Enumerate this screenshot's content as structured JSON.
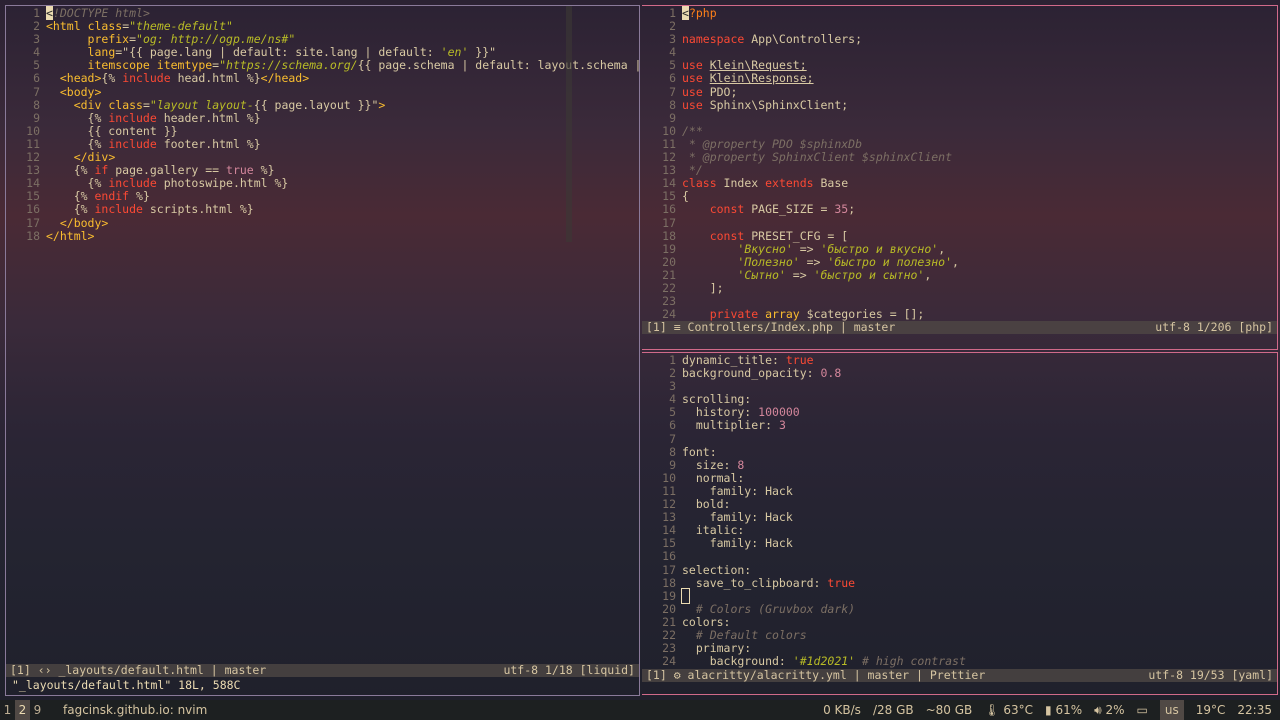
{
  "left_pane": {
    "lines": [
      {
        "n": "1",
        "html": "<span class='cursor'>&lt;</span><span class='cmt'>!DOCTYPE html&gt;</span>"
      },
      {
        "n": "2",
        "html": "<span class='tag'>&lt;html</span> <span class='attr'>class</span>=<span class='str'>\"theme-default\"</span>"
      },
      {
        "n": "3",
        "html": "      <span class='attr'>prefix</span>=<span class='str'>\"og: http://ogp.me/ns#\"</span>"
      },
      {
        "n": "4",
        "html": "      <span class='attr'>lang</span>=\"{{ page.lang | default: site.lang | default: <span class='str'>'en'</span> }}\""
      },
      {
        "n": "5",
        "html": "      <span class='attr'>itemscope itemtype</span>=<span class='str'>\"https://schema.org/</span>{{ page.schema | default: layout.schema | def"
      },
      {
        "n": "6",
        "html": "  <span class='tag'>&lt;head&gt;</span>{% <span class='kw'>include</span> head.html %}<span class='tag'>&lt;/head&gt;</span>"
      },
      {
        "n": "7",
        "html": "  <span class='tag'>&lt;body&gt;</span>"
      },
      {
        "n": "8",
        "html": "    <span class='tag'>&lt;div</span> <span class='attr'>class</span>=<span class='str'>\"layout layout-</span>{{ page.layout }}\"<span class='tag'>&gt;</span>"
      },
      {
        "n": "9",
        "html": "      {% <span class='kw'>include</span> header.html %}"
      },
      {
        "n": "10",
        "html": "      {{ content }}"
      },
      {
        "n": "11",
        "html": "      {% <span class='kw'>include</span> footer.html %}"
      },
      {
        "n": "12",
        "html": "    <span class='tag'>&lt;/div&gt;</span>"
      },
      {
        "n": "13",
        "html": "    {% <span class='kw'>if</span> page.gallery == <span class='num'>true</span> %}"
      },
      {
        "n": "14",
        "html": "      {% <span class='kw'>include</span> photoswipe.html %}"
      },
      {
        "n": "15",
        "html": "    {% <span class='kw'>endif</span> %}"
      },
      {
        "n": "16",
        "html": "    {% <span class='kw'>include</span> scripts.html %}"
      },
      {
        "n": "17",
        "html": "  <span class='tag'>&lt;/body&gt;</span>"
      },
      {
        "n": "18",
        "html": "<span class='tag'>&lt;/html&gt;</span>"
      }
    ],
    "status_left": "[1] ‹› _layouts/default.html | master",
    "status_right": "utf-8 1/18 [liquid]",
    "cmdline": "\"_layouts/default.html\" 18L, 588C"
  },
  "top_right_pane": {
    "lines": [
      {
        "n": "1",
        "html": "<span class='cursor'>&lt;</span><span class='orange'>?php</span>"
      },
      {
        "n": "2",
        "html": ""
      },
      {
        "n": "3",
        "html": "<span class='kw'>namespace</span> App\\Controllers;"
      },
      {
        "n": "4",
        "html": ""
      },
      {
        "n": "5",
        "html": "<span class='kw'>use</span> <u>Klein\\Request;</u>"
      },
      {
        "n": "6",
        "html": "<span class='kw'>use</span> <u>Klein\\Response;</u>"
      },
      {
        "n": "7",
        "html": "<span class='kw'>use</span> PDO;"
      },
      {
        "n": "8",
        "html": "<span class='kw'>use</span> Sphinx\\SphinxClient;"
      },
      {
        "n": "9",
        "html": ""
      },
      {
        "n": "10",
        "html": "<span class='cmt'>/**</span>"
      },
      {
        "n": "11",
        "html": "<span class='cmt'> * @property PDO $sphinxDb</span>"
      },
      {
        "n": "12",
        "html": "<span class='cmt'> * @property SphinxClient $sphinxClient</span>"
      },
      {
        "n": "13",
        "html": "<span class='cmt'> */</span>"
      },
      {
        "n": "14",
        "html": "<span class='kw'>class</span> Index <span class='kw'>extends</span> Base"
      },
      {
        "n": "15",
        "html": "{"
      },
      {
        "n": "16",
        "html": "    <span class='kw'>const</span> PAGE_SIZE = <span class='num'>35</span>;"
      },
      {
        "n": "17",
        "html": ""
      },
      {
        "n": "18",
        "html": "    <span class='kw'>const</span> PRESET_CFG = ["
      },
      {
        "n": "19",
        "html": "        <span class='str'>'Вкусно'</span> =&gt; <span class='str'>'быстро и вкусно'</span>,"
      },
      {
        "n": "20",
        "html": "        <span class='str'>'Полезно'</span> =&gt; <span class='str'>'быстро и полезно'</span>,"
      },
      {
        "n": "21",
        "html": "        <span class='str'>'Сытно'</span> =&gt; <span class='str'>'быстро и сытно'</span>,"
      },
      {
        "n": "22",
        "html": "    ];"
      },
      {
        "n": "23",
        "html": ""
      },
      {
        "n": "24",
        "html": "    <span class='kw'>private</span> <span class='tag'>array</span> $categories = [];"
      }
    ],
    "status_left": "[1] ≡ Controllers/Index.php | master",
    "status_right": "utf-8 1/206 [php]"
  },
  "bottom_right_pane": {
    "lines": [
      {
        "n": "1",
        "html": "dynamic_title: <span class='kw'>true</span>"
      },
      {
        "n": "2",
        "html": "background_opacity: <span class='num'>0.8</span>"
      },
      {
        "n": "3",
        "html": ""
      },
      {
        "n": "4",
        "html": "scrolling:"
      },
      {
        "n": "5",
        "html": "  history: <span class='num'>100000</span>"
      },
      {
        "n": "6",
        "html": "  multiplier: <span class='num'>3</span>"
      },
      {
        "n": "7",
        "html": ""
      },
      {
        "n": "8",
        "html": "font:"
      },
      {
        "n": "9",
        "html": "  size: <span class='num'>8</span>"
      },
      {
        "n": "10",
        "html": "  normal:"
      },
      {
        "n": "11",
        "html": "    family: Hack"
      },
      {
        "n": "12",
        "html": "  bold:"
      },
      {
        "n": "13",
        "html": "    family: Hack"
      },
      {
        "n": "14",
        "html": "  italic:"
      },
      {
        "n": "15",
        "html": "    family: Hack"
      },
      {
        "n": "16",
        "html": ""
      },
      {
        "n": "17",
        "html": "selection:"
      },
      {
        "n": "18",
        "html": "  save_to_clipboard: <span class='kw'>true</span>"
      },
      {
        "n": "19",
        "html": "<span style='outline:1px solid #ebdbb2'> </span>"
      },
      {
        "n": "20",
        "html": "  <span class='cmt'># Colors (Gruvbox dark)</span>"
      },
      {
        "n": "21",
        "html": "colors:"
      },
      {
        "n": "22",
        "html": "  <span class='cmt'># Default colors</span>"
      },
      {
        "n": "23",
        "html": "  primary:"
      },
      {
        "n": "24",
        "html": "    background: <span class='str'>'#1d2021'</span> <span class='cmt'># high contrast</span>"
      }
    ],
    "status_left": "[1] ⚙ alacritty/alacritty.yml | master | Prettier",
    "status_right": "utf-8 19/53 [yaml]"
  },
  "taskbar": {
    "workspaces": [
      "1",
      "2",
      "9"
    ],
    "active_workspace": "2",
    "window_title": "fagcinsk.github.io: nvim",
    "net": "0 KB/s",
    "disk1": "/28 GB",
    "disk2": "~80 GB",
    "temp_cpu": "63°C",
    "battery": "61%",
    "volume": "2%",
    "layout": "us",
    "weather": "19°C",
    "clock": "22:35"
  }
}
